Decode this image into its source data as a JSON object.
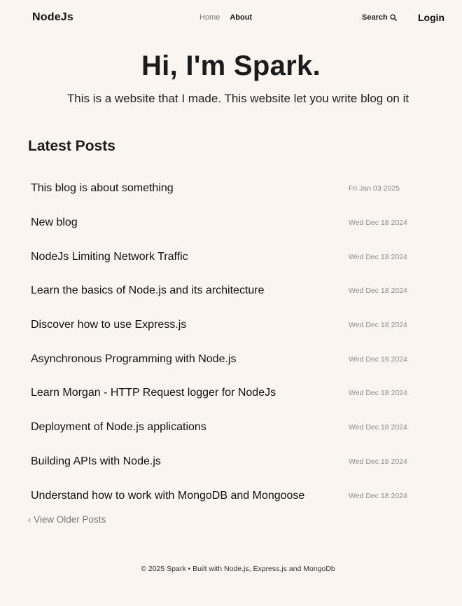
{
  "header": {
    "logo": "NodeJs",
    "nav": {
      "home": "Home",
      "about": "About"
    },
    "search_label": "Search",
    "search_icon": "search-icon",
    "login_label": "Login"
  },
  "hero": {
    "title": "Hi, I'm Spark.",
    "subtitle": "This is a website that I made. This website let you write blog on it"
  },
  "latest": {
    "title": "Latest Posts",
    "posts": [
      {
        "title": "This blog is about something",
        "date": "Fri Jan 03 2025"
      },
      {
        "title": "New blog",
        "date": "Wed Dec 18 2024"
      },
      {
        "title": "NodeJs Limiting Network Traffic",
        "date": "Wed Dec 18 2024"
      },
      {
        "title": "Learn the basics of Node.js and its architecture",
        "date": "Wed Dec 18 2024"
      },
      {
        "title": "Discover how to use Express.js",
        "date": "Wed Dec 18 2024"
      },
      {
        "title": "Asynchronous Programming with Node.js",
        "date": "Wed Dec 18 2024"
      },
      {
        "title": "Learn Morgan - HTTP Request logger for NodeJs",
        "date": "Wed Dec 18 2024"
      },
      {
        "title": "Deployment of Node.js applications",
        "date": "Wed Dec 18 2024"
      },
      {
        "title": "Building APIs with Node.js",
        "date": "Wed Dec 18 2024"
      },
      {
        "title": "Understand how to work with MongoDB and Mongoose",
        "date": "Wed Dec 18 2024"
      }
    ],
    "older_label": "View Older Posts",
    "older_icon": "chevron-left-icon"
  },
  "footer": {
    "text": "© 2025 Spark • Built with Node.js, Express.js and MongoDb"
  },
  "colors": {
    "background": "#faf5f0",
    "text": "#1a1a1a",
    "muted": "#8a8a8a"
  }
}
